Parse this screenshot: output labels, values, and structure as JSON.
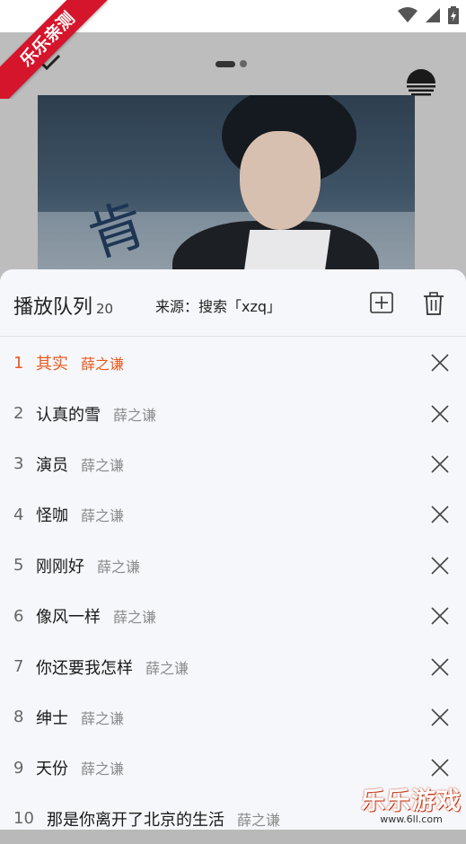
{
  "corner_badge": "乐乐亲测",
  "watermark": {
    "title": "乐乐游戏",
    "url": "www.6ll.com"
  },
  "player": {
    "cover_signature": "肯"
  },
  "queue": {
    "title": "播放队列",
    "count": "20",
    "source": "来源：搜索「xzq」",
    "items": [
      {
        "index": "1",
        "song": "其实",
        "artist": "薛之谦"
      },
      {
        "index": "2",
        "song": "认真的雪",
        "artist": "薛之谦"
      },
      {
        "index": "3",
        "song": "演员",
        "artist": "薛之谦"
      },
      {
        "index": "4",
        "song": "怪咖",
        "artist": "薛之谦"
      },
      {
        "index": "5",
        "song": "刚刚好",
        "artist": "薛之谦"
      },
      {
        "index": "6",
        "song": "像风一样",
        "artist": "薛之谦"
      },
      {
        "index": "7",
        "song": "你还要我怎样",
        "artist": "薛之谦"
      },
      {
        "index": "8",
        "song": "绅士",
        "artist": "薛之谦"
      },
      {
        "index": "9",
        "song": "天份",
        "artist": "薛之谦"
      },
      {
        "index": "10",
        "song": "那是你离开了北京的生活",
        "artist": "薛之谦"
      }
    ]
  },
  "colors": {
    "accent": "#e95a1d",
    "badge": "#d5152b"
  },
  "icons": [
    "chevron-down-icon",
    "equalizer-sun-icon",
    "add-box-icon",
    "trash-icon",
    "close-icon",
    "wifi-icon",
    "signal-icon",
    "battery-icon"
  ]
}
